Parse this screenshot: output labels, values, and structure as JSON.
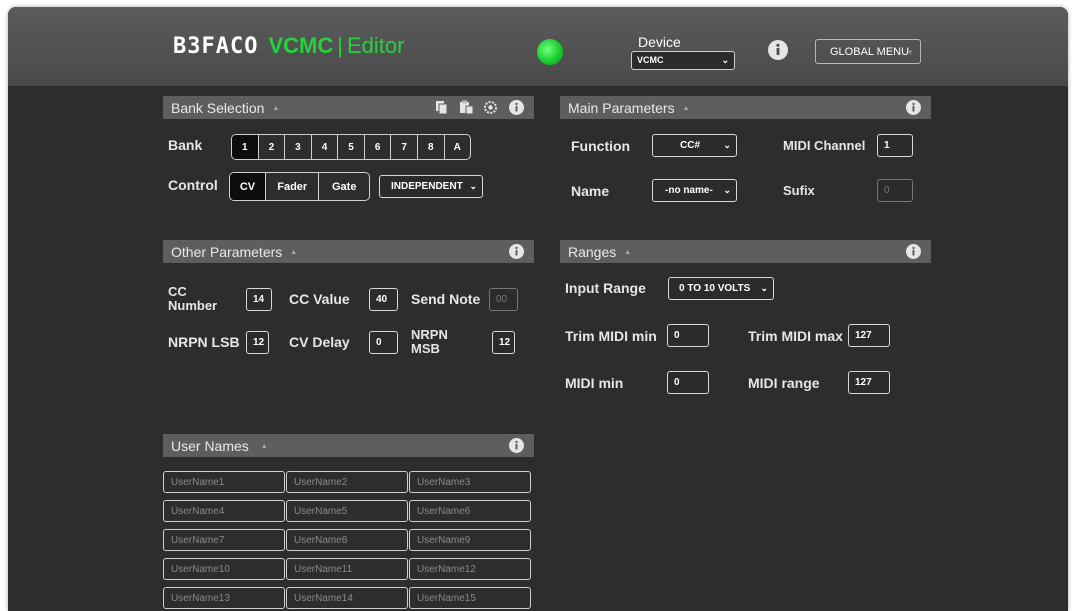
{
  "header": {
    "brand": "B3FACO",
    "product": "VCMC",
    "separator": "|",
    "editor": "Editor",
    "device_label": "Device",
    "device_value": "VCMC",
    "global_menu": "GLOBAL MENU",
    "led_color": "#22d43c"
  },
  "bank_selection": {
    "title": "Bank Selection",
    "bank_label": "Bank",
    "banks": [
      "1",
      "2",
      "3",
      "4",
      "5",
      "6",
      "7",
      "8",
      "A"
    ],
    "active_bank": "1",
    "control_label": "Control",
    "controls": [
      "CV",
      "Fader",
      "Gate"
    ],
    "active_control": "CV",
    "mode_select": "INDEPENDENT",
    "icons": [
      "copy-icon",
      "paste-icon",
      "settings-icon",
      "info-icon"
    ]
  },
  "main_parameters": {
    "title": "Main Parameters",
    "function_label": "Function",
    "function_value": "CC#",
    "midi_channel_label": "MIDI Channel",
    "midi_channel_value": "1",
    "name_label": "Name",
    "name_value": "-no name-",
    "sufix_label": "Sufix",
    "sufix_value": "0"
  },
  "other_parameters": {
    "title": "Other Parameters",
    "cc_number_label": "CC Number",
    "cc_number_value": "14",
    "cc_value_label": "CC Value",
    "cc_value_value": "40",
    "send_note_label": "Send Note",
    "send_note_value": "00",
    "nrpn_lsb_label": "NRPN LSB",
    "nrpn_lsb_value": "12",
    "cv_delay_label": "CV Delay",
    "cv_delay_value": "0",
    "nrpn_msb_label": "NRPN MSB",
    "nrpn_msb_value": "12"
  },
  "ranges": {
    "title": "Ranges",
    "input_range_label": "Input Range",
    "input_range_value": "0 TO 10 VOLTS",
    "trim_min_label": "Trim MIDI min",
    "trim_min_value": "0",
    "trim_max_label": "Trim MIDI max",
    "trim_max_value": "127",
    "midi_min_label": "MIDI min",
    "midi_min_value": "0",
    "midi_range_label": "MIDI range",
    "midi_range_value": "127"
  },
  "user_names": {
    "title": "User Names",
    "placeholders": [
      "UserName1",
      "UserName2",
      "UserName3",
      "UserName4",
      "UserName5",
      "UserName6",
      "UserName7",
      "UserName8",
      "UserName9",
      "UserName10",
      "UserName11",
      "UserName12",
      "UserName13",
      "UserName14",
      "UserName15"
    ]
  },
  "colors": {
    "accent": "#22d43c",
    "panel_header": "#5e5e5e",
    "background": "#2d2d2d"
  }
}
